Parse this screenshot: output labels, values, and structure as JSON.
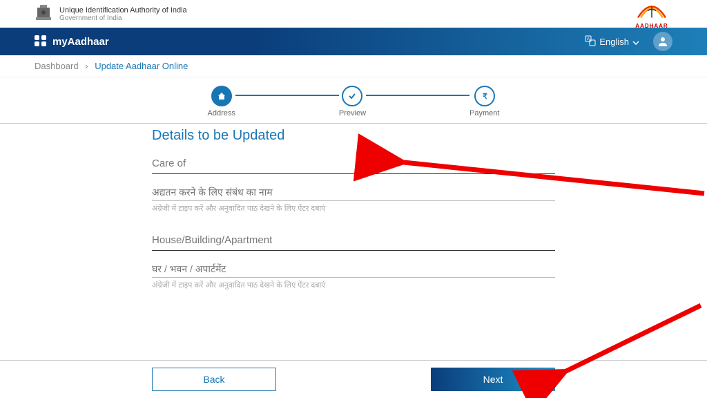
{
  "header": {
    "org_title": "Unique Identification Authority of India",
    "org_sub": "Government of India",
    "logo_text": "AADHAAR"
  },
  "nav": {
    "title": "myAadhaar",
    "language": "English"
  },
  "breadcrumb": {
    "dashboard": "Dashboard",
    "current": "Update Aadhaar Online"
  },
  "stepper": {
    "step1": "Address",
    "step2": "Preview",
    "step3": "Payment"
  },
  "form": {
    "section_title": "Details to be Updated",
    "care_of": {
      "label": "Care of",
      "hindi_placeholder": "अद्यतन करने के लिए संबंध का नाम",
      "helper": "अंग्रेजी में टाइप करें और अनुवादित पाठ देखने के लिए ऐंटर दबाएं"
    },
    "house": {
      "label": "House/Building/Apartment",
      "hindi_placeholder": "घर / भवन / अपार्टमेंट",
      "helper": "अंग्रेजी में टाइप करें और अनुवादित पाठ देखने के लिए ऐंटर दबाएं"
    }
  },
  "buttons": {
    "back": "Back",
    "next": "Next"
  }
}
